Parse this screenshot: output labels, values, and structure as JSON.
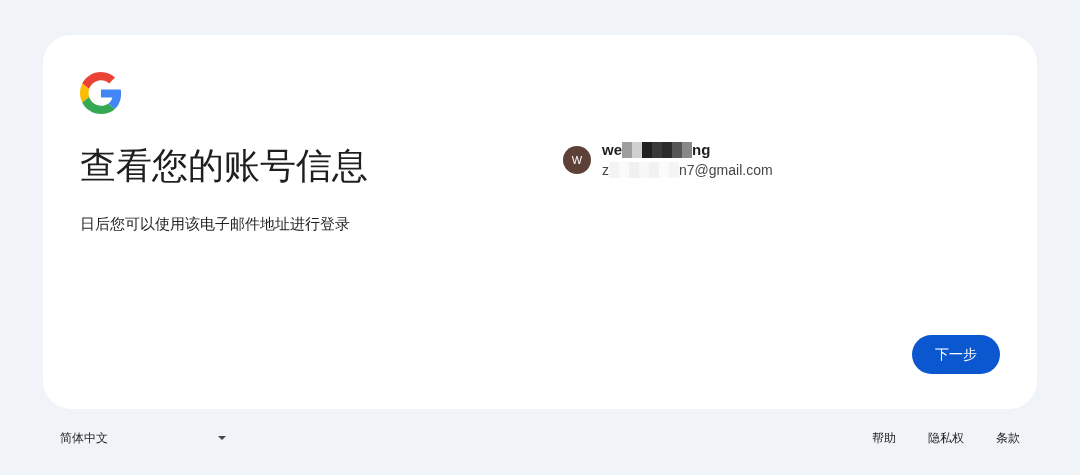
{
  "card": {
    "title": "查看您的账号信息",
    "subtitle": "日后您可以使用该电子邮件地址进行登录",
    "account": {
      "avatar_letter": "W",
      "name_start": "we",
      "name_end": "ng",
      "email_start": "z",
      "email_end": "n7@gmail.com"
    },
    "next_button": "下一步"
  },
  "footer": {
    "language": "简体中文",
    "links": [
      "帮助",
      "隐私权",
      "条款"
    ]
  }
}
